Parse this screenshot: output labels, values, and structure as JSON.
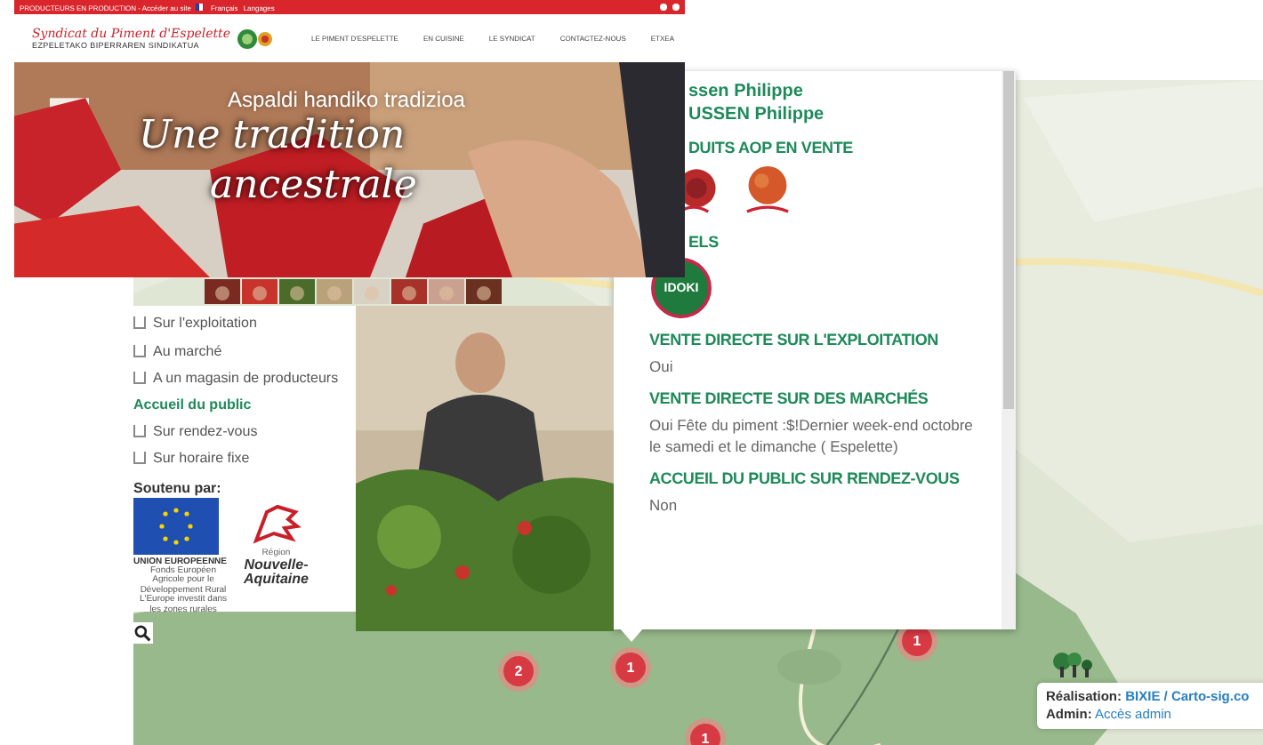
{
  "site": {
    "top_bar": {
      "text": "PRODUCTEURS EN PRODUCTION - Accéder au site",
      "language": "Français",
      "languages_link": "Langages"
    },
    "logo": {
      "title": "Syndicat du Piment d'Espelette",
      "subtitle": "EZPELETAKO BIPERRAREN SINDIKATUA"
    },
    "nav": [
      {
        "label": "LE PIMENT D'ESPELETTE",
        "selected": false
      },
      {
        "label": "EN CUISINE",
        "selected": false
      },
      {
        "label": "LE SYNDICAT",
        "selected": false
      },
      {
        "label": "CONTACTEZ-NOUS",
        "selected": false
      },
      {
        "label": "ETXEA",
        "selected": false
      }
    ],
    "hero": {
      "kicker": "Aspaldi handiko tradizioa",
      "headline": [
        "Une tradition",
        "ancestrale"
      ]
    }
  },
  "filter_panel": {
    "sale_options": [
      {
        "label": "Sur l'exploitation",
        "checked": false
      },
      {
        "label": "Au marché",
        "checked": false
      },
      {
        "label": "A un magasin de producteurs",
        "checked": false
      }
    ],
    "public_title": "Accueil du public",
    "public_options": [
      {
        "label": "Sur rendez-vous",
        "checked": false
      },
      {
        "label": "Sur horaire fixe",
        "checked": false
      }
    ],
    "supported_by": "Soutenu par:",
    "eu": {
      "title": "UNION EUROPEENNE",
      "lines": [
        "Fonds Européen Agricole pour le Développement Rural",
        "L'Europe investit dans les zones rurales"
      ]
    },
    "region": {
      "small": "Région",
      "name": [
        "Nouvelle-",
        "Aquitaine"
      ]
    }
  },
  "popup": {
    "names": [
      "ssen Philippe",
      "USSEN Philippe"
    ],
    "products_heading": "DUITS AOP EN VENTE",
    "labels_heading": "ELS",
    "label_badge": "IDOKI",
    "fields": [
      {
        "heading": "VENTE DIRECTE SUR L'EXPLOITATION",
        "value": "Oui"
      },
      {
        "heading": "VENTE DIRECTE SUR DES MARCHÉS",
        "value": "Oui Fête du piment :$!Dernier week-end octobre le samedi et le dimanche ( Espelette)"
      },
      {
        "heading": "ACCUEIL DU PUBLIC SUR RENDEZ-VOUS",
        "value": "Non"
      }
    ]
  },
  "map": {
    "markers": [
      {
        "count": "1"
      },
      {
        "count": "2"
      },
      {
        "count": "1"
      },
      {
        "count": "1"
      }
    ],
    "attribution": {
      "label": "Réalisation:",
      "link": "BIXIE / Carto-sig.co",
      "admin_label": "Admin:",
      "admin_link": "Accès admin"
    }
  }
}
